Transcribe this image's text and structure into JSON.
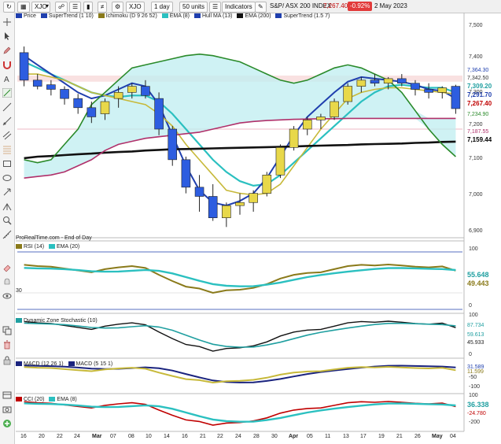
{
  "toolbar": {
    "ticker": "XJO",
    "timeframe": "1 day",
    "units": "50 units",
    "indicators_label": "Indicators",
    "instrument": "S&P/ ASX 200 INDEX",
    "last_price": "7,267.40",
    "change": "-0.92%",
    "date": "2 May 2023"
  },
  "legend": [
    {
      "label": "Price",
      "color": "#1f3fae"
    },
    {
      "label": "SuperTrend (1 10)",
      "color": "#1f3fae"
    },
    {
      "label": "Ichimoku (D 9 26 52)",
      "color": "#8a7a1a"
    },
    {
      "label": "EMA (8)",
      "color": "#2bc0c0"
    },
    {
      "label": "Hull MA (13)",
      "color": "#1f3fae"
    },
    {
      "label": "EMA (200)",
      "color": "#111111"
    },
    {
      "label": "SuperTrend (1.5 7)",
      "color": "#1f3fae"
    }
  ],
  "source_note": "ProRealTime.com - End of Day",
  "price_axis": {
    "ticks": [
      "7,500",
      "7,400",
      "7,300",
      "7,200",
      "7,100",
      "7,000",
      "6,900"
    ],
    "tags": [
      {
        "text": "7,364.30",
        "bg": "#ffffff",
        "fg": "#1f3fae"
      },
      {
        "text": "7,342.50",
        "bg": "#ffffff",
        "fg": "#333333"
      },
      {
        "text": "7,309.20",
        "bg": "#ffffff",
        "fg": "#1f9fa0"
      },
      {
        "text": "7,291.70",
        "bg": "#ffffff",
        "fg": "#1f3fae"
      },
      {
        "text": "7,267.40",
        "bg": "#ffffff",
        "fg": "#c00000"
      },
      {
        "text": "7,234.90",
        "bg": "#ffffff",
        "fg": "#2a8a2a"
      },
      {
        "text": "7,187.55",
        "bg": "#ffffff",
        "fg": "#b0306a"
      },
      {
        "text": "7,159.44",
        "bg": "#ffffff",
        "fg": "#000000"
      }
    ]
  },
  "x_axis_labels": [
    "16",
    "20",
    "22",
    "24",
    "Mar",
    "07",
    "08",
    "10",
    "14",
    "16",
    "21",
    "22",
    "24",
    "28",
    "30",
    "Apr",
    "05",
    "11",
    "13",
    "17",
    "19",
    "21",
    "26",
    "May",
    "04"
  ],
  "panels": {
    "rsi": {
      "title_a": "RSI (14)",
      "title_b": "EMA (20)",
      "ticks": [
        "100",
        "30",
        "0"
      ],
      "tag_a": "55.648",
      "tag_b": "49.443"
    },
    "dzs": {
      "title": "Dynamic Zone Stochastic (10)",
      "ticks": [
        "100",
        "0"
      ],
      "tag_a": "87.734",
      "tag_b": "59.613",
      "tag_c": "45.933"
    },
    "macd": {
      "title_a": "MACD (12 26 1)",
      "title_b": "MACD (5 15 1)",
      "ticks": [
        "-50",
        "-100"
      ],
      "tag_a": "31.589",
      "tag_b": "11.599"
    },
    "cci": {
      "title_a": "CCI (20)",
      "title_b": "EMA (8)",
      "ticks": [
        "100",
        "-200"
      ],
      "tag_a": "36.338",
      "tag_b": "-24.780"
    }
  },
  "chart_data": {
    "type": "line",
    "title": "S&P/ ASX 200 INDEX",
    "x": [
      "16",
      "20",
      "22",
      "24",
      "Mar",
      "07",
      "08",
      "10",
      "14",
      "16",
      "21",
      "22",
      "24",
      "28",
      "30",
      "Apr",
      "05",
      "11",
      "13",
      "17",
      "19",
      "21",
      "26",
      "May",
      "04"
    ],
    "ylim": [
      6850,
      7550
    ],
    "candles": [
      {
        "o": 7450,
        "h": 7470,
        "l": 7340,
        "c": 7360
      },
      {
        "o": 7360,
        "h": 7380,
        "l": 7330,
        "c": 7340
      },
      {
        "o": 7345,
        "h": 7360,
        "l": 7310,
        "c": 7330
      },
      {
        "o": 7330,
        "h": 7340,
        "l": 7280,
        "c": 7300
      },
      {
        "o": 7300,
        "h": 7315,
        "l": 7250,
        "c": 7270
      },
      {
        "o": 7270,
        "h": 7290,
        "l": 7220,
        "c": 7240
      },
      {
        "o": 7250,
        "h": 7300,
        "l": 7230,
        "c": 7290
      },
      {
        "o": 7300,
        "h": 7340,
        "l": 7270,
        "c": 7320
      },
      {
        "o": 7320,
        "h": 7350,
        "l": 7300,
        "c": 7340
      },
      {
        "o": 7340,
        "h": 7360,
        "l": 7300,
        "c": 7310
      },
      {
        "o": 7300,
        "h": 7320,
        "l": 7180,
        "c": 7200
      },
      {
        "o": 7200,
        "h": 7210,
        "l": 7080,
        "c": 7100
      },
      {
        "o": 7100,
        "h": 7110,
        "l": 6990,
        "c": 7010
      },
      {
        "o": 7010,
        "h": 7050,
        "l": 6930,
        "c": 6980
      },
      {
        "o": 6980,
        "h": 7020,
        "l": 6900,
        "c": 6910
      },
      {
        "o": 6910,
        "h": 6960,
        "l": 6880,
        "c": 6950
      },
      {
        "o": 6950,
        "h": 6990,
        "l": 6920,
        "c": 6960
      },
      {
        "o": 6960,
        "h": 7000,
        "l": 6930,
        "c": 6990
      },
      {
        "o": 6990,
        "h": 7060,
        "l": 6980,
        "c": 7050
      },
      {
        "o": 7050,
        "h": 7150,
        "l": 7040,
        "c": 7140
      },
      {
        "o": 7140,
        "h": 7210,
        "l": 7130,
        "c": 7200
      },
      {
        "o": 7200,
        "h": 7240,
        "l": 7180,
        "c": 7230
      },
      {
        "o": 7230,
        "h": 7250,
        "l": 7200,
        "c": 7240
      },
      {
        "o": 7240,
        "h": 7300,
        "l": 7230,
        "c": 7290
      },
      {
        "o": 7290,
        "h": 7350,
        "l": 7280,
        "c": 7340
      },
      {
        "o": 7340,
        "h": 7370,
        "l": 7320,
        "c": 7360
      },
      {
        "o": 7360,
        "h": 7380,
        "l": 7340,
        "c": 7350
      },
      {
        "o": 7350,
        "h": 7370,
        "l": 7330,
        "c": 7365
      },
      {
        "o": 7365,
        "h": 7380,
        "l": 7340,
        "c": 7350
      },
      {
        "o": 7350,
        "h": 7360,
        "l": 7310,
        "c": 7330
      },
      {
        "o": 7330,
        "h": 7350,
        "l": 7300,
        "c": 7320
      },
      {
        "o": 7320,
        "h": 7340,
        "l": 7300,
        "c": 7335
      },
      {
        "o": 7340,
        "h": 7345,
        "l": 7250,
        "c": 7267
      }
    ],
    "series": [
      {
        "key": "ema8",
        "color": "#2bc0c0",
        "values": [
          7420,
          7400,
          7380,
          7360,
          7340,
          7320,
          7310,
          7305,
          7310,
          7310,
          7290,
          7250,
          7200,
          7150,
          7100,
          7060,
          7030,
          7015,
          7020,
          7050,
          7090,
          7130,
          7170,
          7210,
          7250,
          7290,
          7320,
          7340,
          7345,
          7340,
          7335,
          7335,
          7320
        ]
      },
      {
        "key": "hull",
        "color": "#1f3fae",
        "values": [
          7440,
          7410,
          7380,
          7350,
          7320,
          7300,
          7310,
          7330,
          7350,
          7340,
          7280,
          7180,
          7080,
          7000,
          6960,
          6950,
          6965,
          6990,
          7040,
          7110,
          7180,
          7240,
          7280,
          7320,
          7355,
          7370,
          7365,
          7360,
          7355,
          7345,
          7330,
          7325,
          7300
        ]
      },
      {
        "key": "kijun",
        "color": "#c7b93a",
        "values": [
          7380,
          7380,
          7370,
          7360,
          7340,
          7320,
          7310,
          7300,
          7290,
          7280,
          7250,
          7210,
          7150,
          7100,
          7050,
          7000,
          6990,
          6985,
          6990,
          7020,
          7080,
          7140,
          7200,
          7250,
          7300,
          7320,
          7330,
          7335,
          7335,
          7330,
          7325,
          7320,
          7315
        ]
      },
      {
        "key": "ema200",
        "color": "#111111",
        "values": [
          7105,
          7110,
          7112,
          7115,
          7118,
          7120,
          7123,
          7125,
          7127,
          7130,
          7132,
          7134,
          7135,
          7136,
          7137,
          7138,
          7139,
          7140,
          7141,
          7142,
          7143,
          7145,
          7146,
          7147,
          7148,
          7150,
          7151,
          7152,
          7153,
          7155,
          7156,
          7158,
          7159
        ]
      },
      {
        "key": "senkou_a",
        "color": "#2a8a2a",
        "values": [
          7100,
          7090,
          7100,
          7150,
          7200,
          7280,
          7320,
          7360,
          7400,
          7410,
          7420,
          7430,
          7440,
          7445,
          7440,
          7430,
          7420,
          7400,
          7380,
          7360,
          7350,
          7360,
          7380,
          7400,
          7410,
          7400,
          7380,
          7360,
          7320,
          7260,
          7200,
          7150,
          7110
        ]
      },
      {
        "key": "senkou_b",
        "color": "#b0306a",
        "values": [
          7040,
          7045,
          7050,
          7060,
          7080,
          7100,
          7130,
          7150,
          7160,
          7170,
          7175,
          7180,
          7185,
          7190,
          7200,
          7210,
          7220,
          7225,
          7228,
          7230,
          7232,
          7233,
          7234,
          7234,
          7235,
          7235,
          7235,
          7235,
          7235,
          7235,
          7235,
          7235,
          7235
        ]
      }
    ]
  }
}
